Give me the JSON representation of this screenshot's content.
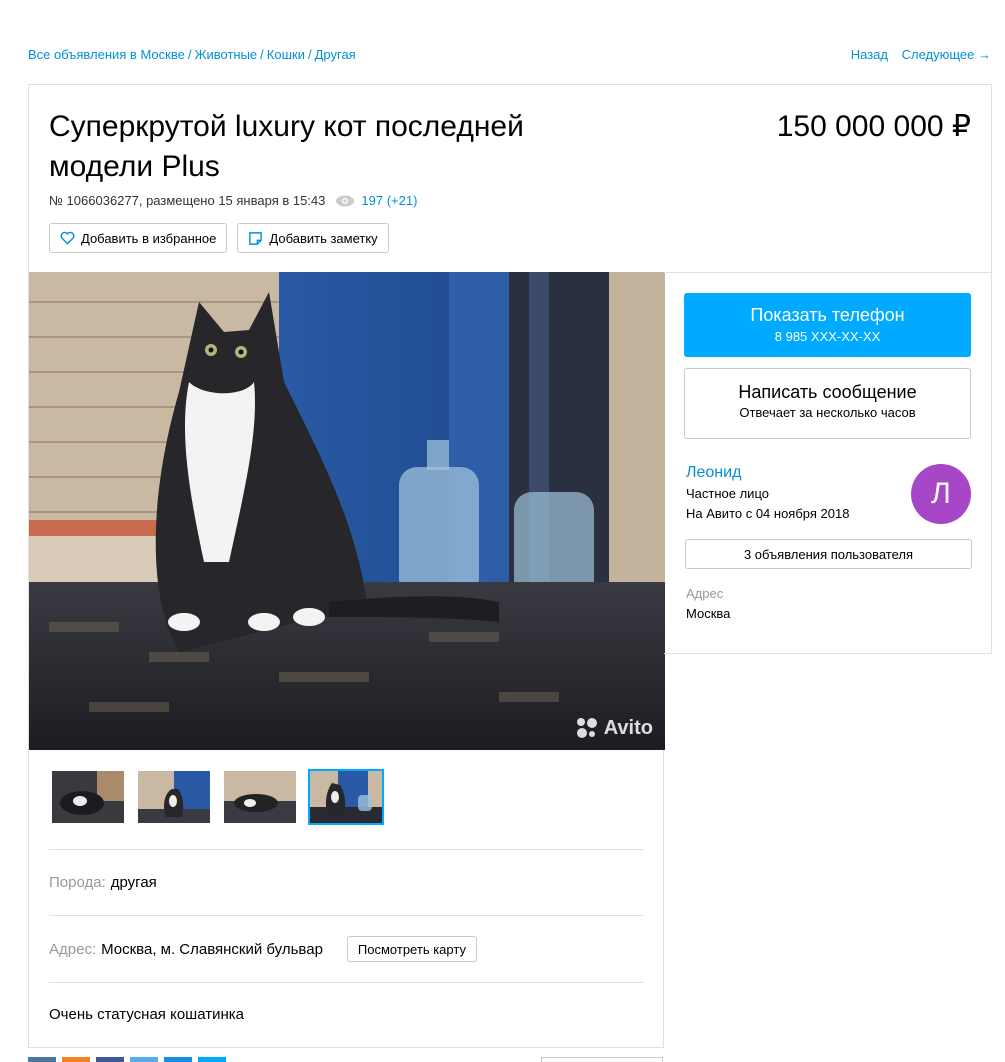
{
  "breadcrumb": {
    "items": [
      "Все объявления в Москве",
      "Животные",
      "Кошки",
      "Другая"
    ],
    "separator": "/"
  },
  "topnav": {
    "back": "Назад",
    "next": "Следующее →"
  },
  "listing": {
    "title": "Суперкрутой luxury кот последней модели Plus",
    "price": "150 000 000 ₽",
    "meta": "№ 1066036277, размещено 15 января в 15:43",
    "views": "197 (+21)",
    "favorite_label": "Добавить в избранное",
    "note_label": "Добавить заметку"
  },
  "photo": {
    "watermark": "Avito",
    "thumbnail_count": 4,
    "active_thumbnail": 4
  },
  "params": {
    "breed_label": "Порода:",
    "breed_value": "другая",
    "address_label": "Адрес:",
    "address_value": "Москва, м. Славянский бульвар",
    "map_button": "Посмотреть карту",
    "description": "Очень статусная кошатинка"
  },
  "seller": {
    "phone_button": "Показать телефон",
    "phone_masked": "8 985 XXX-XX-XX",
    "message_button": "Написать сообщение",
    "message_sub": "Отвечает за несколько часов",
    "name": "Леонид",
    "type": "Частное лицо",
    "since": "На Авито с 04 ноября 2018",
    "avatar_letter": "Л",
    "ads_button": "3 объявления пользователя",
    "address_label": "Адрес",
    "address_value": "Москва"
  },
  "colors": {
    "link": "#0091d9",
    "primary_button": "#00aaff",
    "avatar": "#a846c8"
  }
}
